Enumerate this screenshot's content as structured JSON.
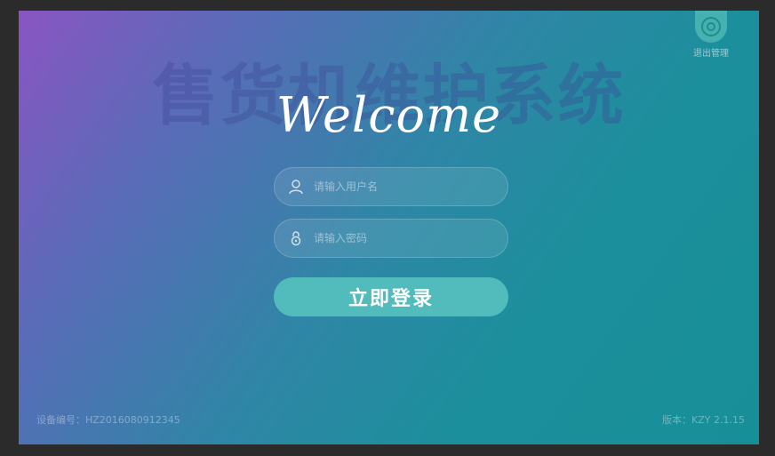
{
  "app": {
    "background_title": "售货机维护系统",
    "welcome_text": "Welcome"
  },
  "header": {
    "exit_label": "退出管理",
    "exit_icon": "exit-circle-icon"
  },
  "form": {
    "username": {
      "placeholder": "请输入用户名",
      "value": "",
      "icon": "user-icon"
    },
    "password": {
      "placeholder": "请输入密码",
      "value": "",
      "icon": "lock-icon"
    },
    "login_label": "立即登录"
  },
  "footer": {
    "device_id": "设备编号：HZ2016080912345",
    "version": "版本：KZY 2.1.15"
  },
  "colors": {
    "gradient_start": "#8a55c2",
    "gradient_end": "#178f98",
    "button": "#52bcbc",
    "exit_icon": "#7adcc8"
  }
}
